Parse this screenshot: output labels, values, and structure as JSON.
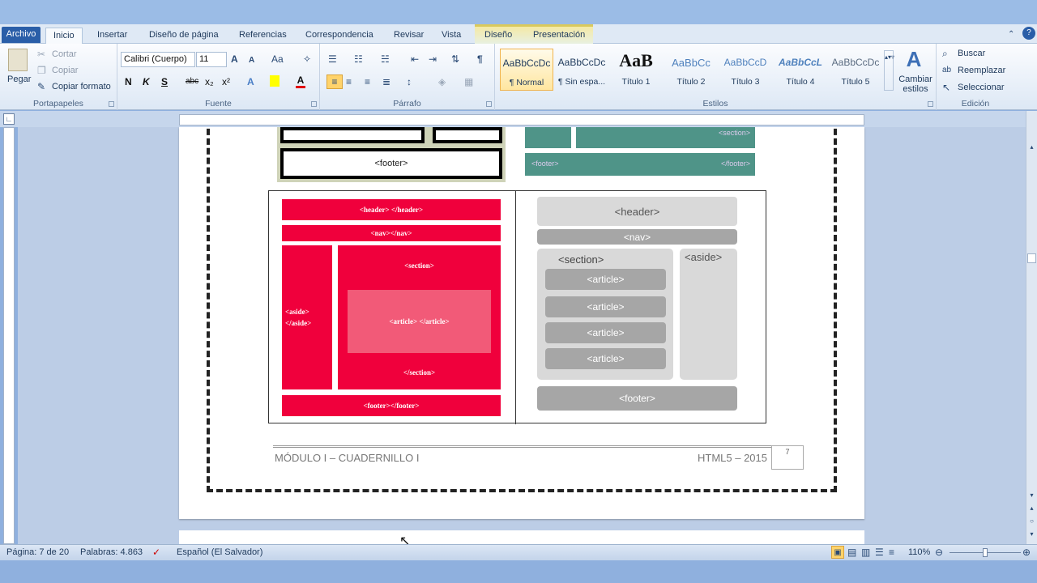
{
  "tabs": {
    "file": "Archivo",
    "home": "Inicio",
    "insert": "Insertar",
    "page_layout": "Diseño de página",
    "references": "Referencias",
    "mailings": "Correspondencia",
    "review": "Revisar",
    "view": "Vista",
    "design": "Diseño",
    "layout": "Presentación"
  },
  "clipboard": {
    "paste": "Pegar",
    "cut": "Cortar",
    "copy": "Copiar",
    "format_painter": "Copiar formato",
    "label": "Portapapeles"
  },
  "font": {
    "name": "Calibri (Cuerpo)",
    "size": "11",
    "label": "Fuente",
    "bold": "N",
    "italic": "K",
    "underline": "S",
    "strike": "abc",
    "sub": "x₂",
    "sup": "x²",
    "grow": "A",
    "shrink": "A",
    "case": "Aa"
  },
  "paragraph": {
    "label": "Párrafo"
  },
  "styles": {
    "label": "Estilos",
    "change": "Cambiar estilos",
    "items": [
      {
        "preview": "AaBbCcDc",
        "name": "¶ Normal"
      },
      {
        "preview": "AaBbCcDc",
        "name": "¶ Sin espa..."
      },
      {
        "preview": "AaB",
        "name": "Título 1"
      },
      {
        "preview": "AaBbCc",
        "name": "Título 2"
      },
      {
        "preview": "AaBbCcD",
        "name": "Título 3"
      },
      {
        "preview": "AaBbCcL",
        "name": "Título 4"
      },
      {
        "preview": "AaBbCcDc",
        "name": "Título 5"
      }
    ]
  },
  "editing": {
    "label": "Edición",
    "find": "Buscar",
    "replace": "Reemplazar",
    "select": "Seleccionar"
  },
  "doc": {
    "left_top": {
      "footer": "<footer>"
    },
    "right_top": {
      "section": "<section>",
      "footer_l": "<footer>",
      "footer_r": "</footer>"
    },
    "left": {
      "header": "<header> </header>",
      "nav": "<nav></nav>",
      "section_open": "<section>",
      "aside": "<aside> </aside>",
      "article": "<article> </article>",
      "section_close": "</section>",
      "footer": "<footer></footer>"
    },
    "right": {
      "header": "<header>",
      "nav": "<nav>",
      "section": "<section>",
      "aside": "<aside>",
      "article": "<article>",
      "footer": "<footer>"
    },
    "footer_left": "MÓDULO I – CUADERNILLO I",
    "footer_right": "HTML5 – 2015",
    "page_num": "7"
  },
  "status": {
    "page": "Página: 7 de 20",
    "words": "Palabras: 4.863",
    "lang": "Español (El Salvador)",
    "zoom": "110%"
  },
  "colors": {
    "red": "#f0003c",
    "teal": "#4f9488",
    "gray": "#a6a6a6",
    "light_gray": "#d9d9d9"
  }
}
